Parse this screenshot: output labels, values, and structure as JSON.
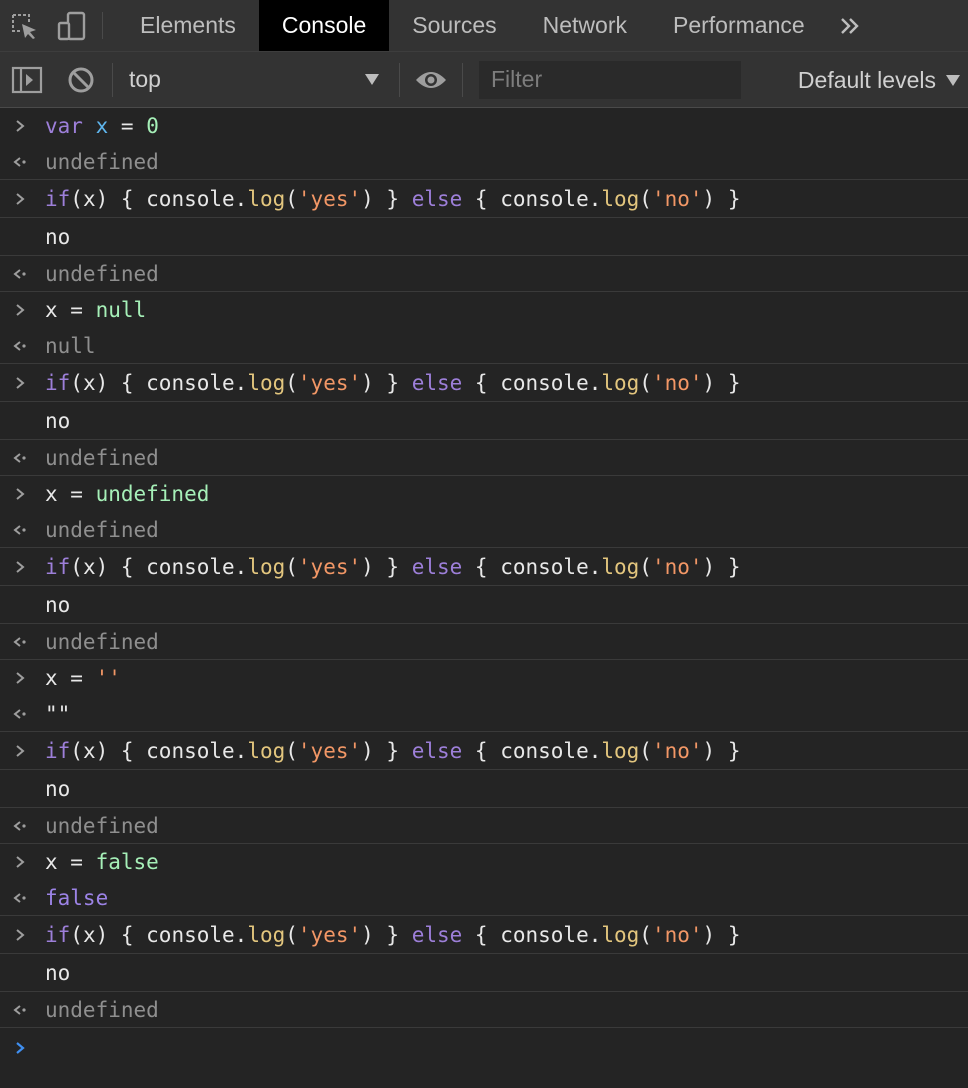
{
  "tabs": [
    {
      "label": "Elements",
      "active": false
    },
    {
      "label": "Console",
      "active": true
    },
    {
      "label": "Sources",
      "active": false
    },
    {
      "label": "Network",
      "active": false
    },
    {
      "label": "Performance",
      "active": false
    }
  ],
  "toolbar": {
    "context_value": "top",
    "filter_placeholder": "Filter",
    "levels_label": "Default levels"
  },
  "console_entries": [
    {
      "kind": "input",
      "tokens": [
        [
          "k",
          "var"
        ],
        [
          "p",
          " "
        ],
        [
          "v",
          "x"
        ],
        [
          "p",
          " = "
        ],
        [
          "n",
          "0"
        ]
      ]
    },
    {
      "kind": "result",
      "text": "undefined"
    },
    {
      "kind": "input",
      "tokens": [
        [
          "k",
          "if"
        ],
        [
          "p",
          "(x) { console."
        ],
        [
          "f",
          "log"
        ],
        [
          "p",
          "("
        ],
        [
          "s",
          "'yes'"
        ],
        [
          "p",
          ") } "
        ],
        [
          "k",
          "else"
        ],
        [
          "p",
          " { console."
        ],
        [
          "f",
          "log"
        ],
        [
          "p",
          "("
        ],
        [
          "s",
          "'no'"
        ],
        [
          "p",
          ") }"
        ]
      ]
    },
    {
      "kind": "log",
      "text": "no"
    },
    {
      "kind": "result",
      "text": "undefined"
    },
    {
      "kind": "input",
      "tokens": [
        [
          "p",
          "x = "
        ],
        [
          "n",
          "null"
        ]
      ]
    },
    {
      "kind": "result",
      "text": "null"
    },
    {
      "kind": "input",
      "tokens": [
        [
          "k",
          "if"
        ],
        [
          "p",
          "(x) { console."
        ],
        [
          "f",
          "log"
        ],
        [
          "p",
          "("
        ],
        [
          "s",
          "'yes'"
        ],
        [
          "p",
          ") } "
        ],
        [
          "k",
          "else"
        ],
        [
          "p",
          " { console."
        ],
        [
          "f",
          "log"
        ],
        [
          "p",
          "("
        ],
        [
          "s",
          "'no'"
        ],
        [
          "p",
          ") }"
        ]
      ]
    },
    {
      "kind": "log",
      "text": "no"
    },
    {
      "kind": "result",
      "text": "undefined"
    },
    {
      "kind": "input",
      "tokens": [
        [
          "p",
          "x = "
        ],
        [
          "n",
          "undefined"
        ]
      ]
    },
    {
      "kind": "result",
      "text": "undefined"
    },
    {
      "kind": "input",
      "tokens": [
        [
          "k",
          "if"
        ],
        [
          "p",
          "(x) { console."
        ],
        [
          "f",
          "log"
        ],
        [
          "p",
          "("
        ],
        [
          "s",
          "'yes'"
        ],
        [
          "p",
          ") } "
        ],
        [
          "k",
          "else"
        ],
        [
          "p",
          " { console."
        ],
        [
          "f",
          "log"
        ],
        [
          "p",
          "("
        ],
        [
          "s",
          "'no'"
        ],
        [
          "p",
          ") }"
        ]
      ]
    },
    {
      "kind": "log",
      "text": "no"
    },
    {
      "kind": "result",
      "text": "undefined"
    },
    {
      "kind": "input",
      "tokens": [
        [
          "p",
          "x = "
        ],
        [
          "s",
          "''"
        ]
      ]
    },
    {
      "kind": "result_plain",
      "text": "\"\""
    },
    {
      "kind": "input",
      "tokens": [
        [
          "k",
          "if"
        ],
        [
          "p",
          "(x) { console."
        ],
        [
          "f",
          "log"
        ],
        [
          "p",
          "("
        ],
        [
          "s",
          "'yes'"
        ],
        [
          "p",
          ") } "
        ],
        [
          "k",
          "else"
        ],
        [
          "p",
          " { console."
        ],
        [
          "f",
          "log"
        ],
        [
          "p",
          "("
        ],
        [
          "s",
          "'no'"
        ],
        [
          "p",
          ") }"
        ]
      ]
    },
    {
      "kind": "log",
      "text": "no"
    },
    {
      "kind": "result",
      "text": "undefined"
    },
    {
      "kind": "input",
      "tokens": [
        [
          "p",
          "x = "
        ],
        [
          "n",
          "false"
        ]
      ]
    },
    {
      "kind": "result_bool",
      "text": "false"
    },
    {
      "kind": "input",
      "tokens": [
        [
          "k",
          "if"
        ],
        [
          "p",
          "(x) { console."
        ],
        [
          "f",
          "log"
        ],
        [
          "p",
          "("
        ],
        [
          "s",
          "'yes'"
        ],
        [
          "p",
          ") } "
        ],
        [
          "k",
          "else"
        ],
        [
          "p",
          " { console."
        ],
        [
          "f",
          "log"
        ],
        [
          "p",
          "("
        ],
        [
          "s",
          "'no'"
        ],
        [
          "p",
          ") }"
        ]
      ]
    },
    {
      "kind": "log",
      "text": "no"
    },
    {
      "kind": "result",
      "text": "undefined"
    }
  ],
  "colors": {
    "accent_prompt": "#3f8ff0",
    "keyword": "#9d7fd9",
    "string": "#f29766",
    "method": "#e3c67e",
    "literal": "#a6f0b8"
  }
}
